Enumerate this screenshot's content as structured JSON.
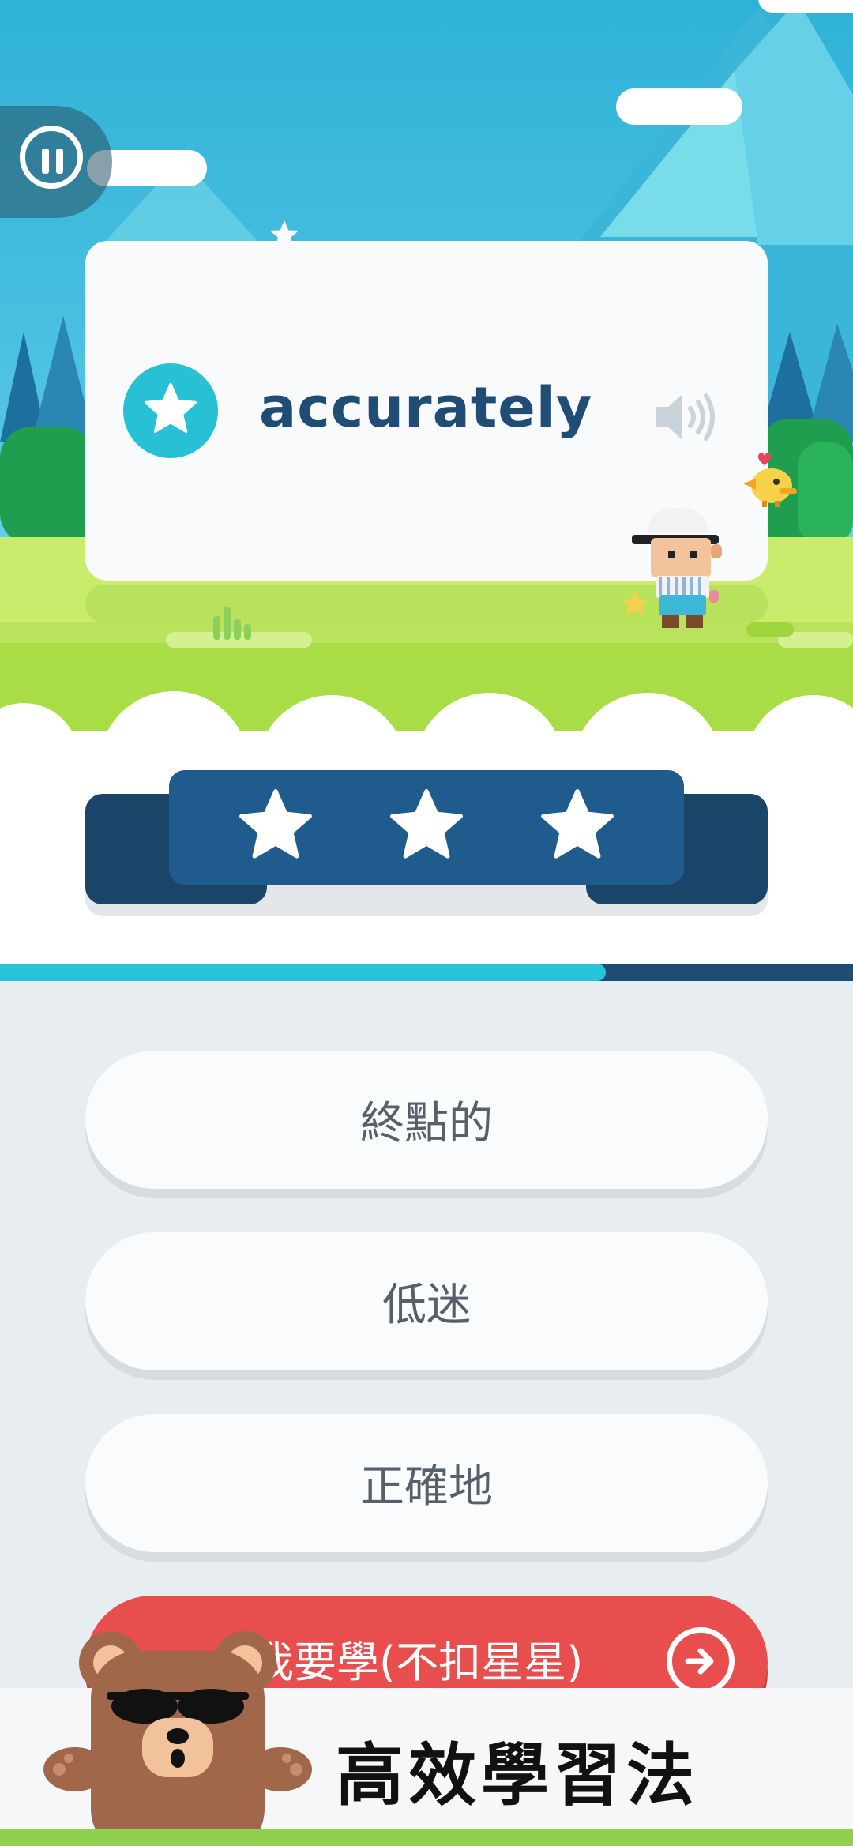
{
  "quiz": {
    "word": "accurately",
    "stars_earned": 3,
    "stars_total": 3,
    "progress": 0.71
  },
  "answers": [
    {
      "label": "終點的"
    },
    {
      "label": "低迷"
    },
    {
      "label": "正確地"
    }
  ],
  "skip": {
    "label": "我要學(不扣星星)"
  },
  "ad": {
    "label": "高效學習法"
  },
  "colors": {
    "word": "#1f4d76",
    "accent_cyan": "#27c0d4",
    "skip_red": "#e94e4e",
    "score_navy": "#1f4d76",
    "grass": "#a8dd46"
  },
  "icons": {
    "pause": "pause-icon",
    "star": "star-icon",
    "speaker": "speaker-icon",
    "arrow": "arrow-right-circle-icon"
  }
}
